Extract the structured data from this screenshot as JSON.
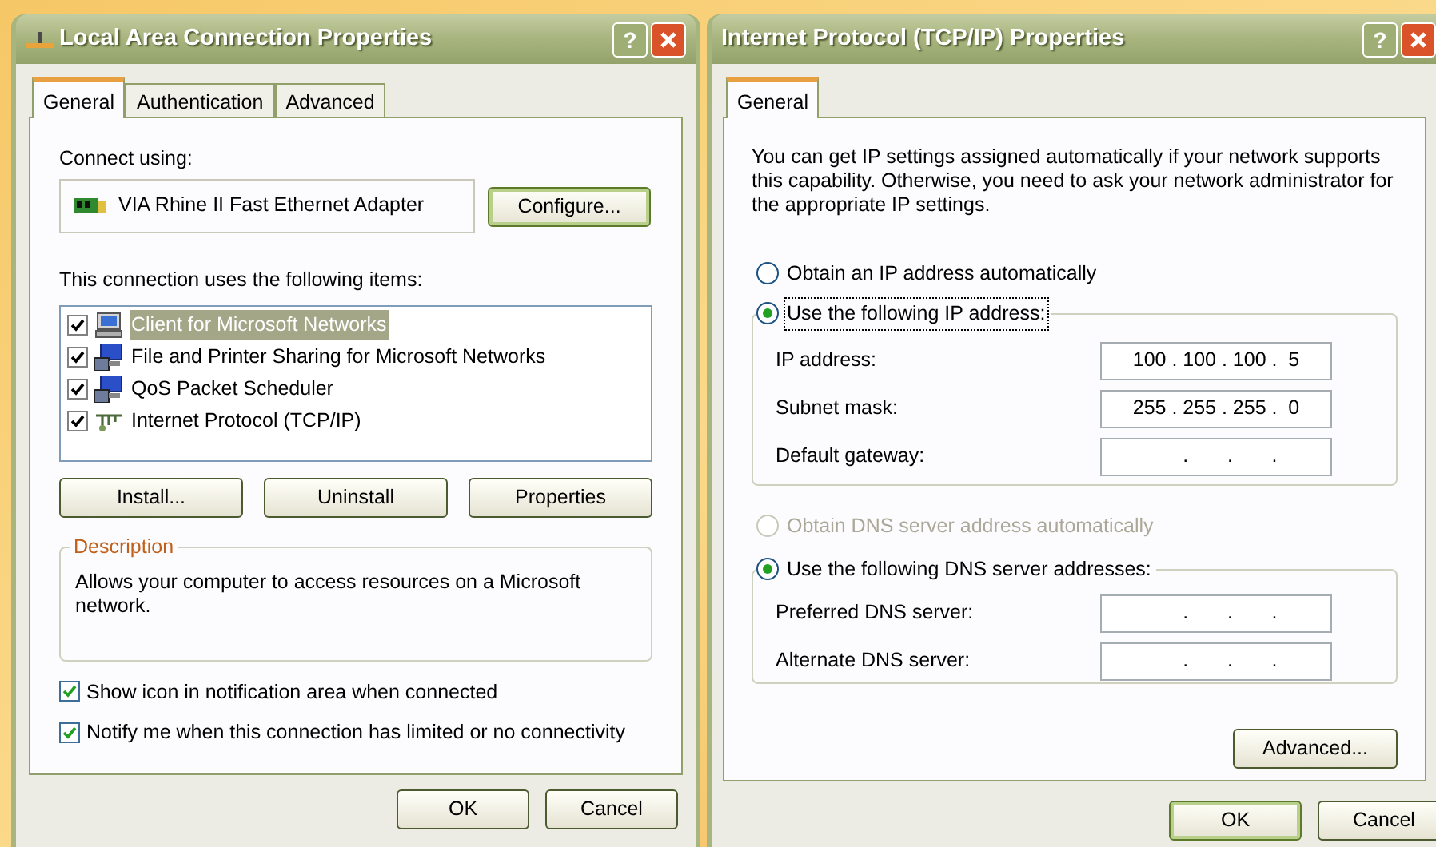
{
  "lan_dialog": {
    "title": "Local Area Connection Properties",
    "help_button": "?",
    "tabs": [
      {
        "label": "General",
        "selected": true
      },
      {
        "label": "Authentication",
        "selected": false
      },
      {
        "label": "Advanced",
        "selected": false
      }
    ],
    "connect_using_label": "Connect using:",
    "adapter": "VIA Rhine II Fast Ethernet Adapter",
    "configure_button": "Configure...",
    "items_label": "This connection uses the following items:",
    "items": [
      {
        "label": "Client for Microsoft Networks",
        "checked": true,
        "selected": true,
        "kind": "client"
      },
      {
        "label": "File and Printer Sharing for Microsoft Networks",
        "checked": true,
        "selected": false,
        "kind": "service"
      },
      {
        "label": "QoS Packet Scheduler",
        "checked": true,
        "selected": false,
        "kind": "service"
      },
      {
        "label": "Internet Protocol (TCP/IP)",
        "checked": true,
        "selected": false,
        "kind": "protocol"
      }
    ],
    "item_buttons": [
      "Install...",
      "Uninstall",
      "Properties"
    ],
    "description": {
      "legend": "Description",
      "text": "Allows your computer to access resources on a Microsoft network."
    },
    "options": [
      {
        "label": "Show icon in notification area when connected",
        "checked": true
      },
      {
        "label": "Notify me when this connection has limited or no connectivity",
        "checked": true
      }
    ],
    "buttons": [
      "OK",
      "Cancel"
    ]
  },
  "tcpip_dialog": {
    "title": "Internet Protocol (TCP/IP) Properties",
    "help_button": "?",
    "tabs": [
      {
        "label": "General",
        "selected": true
      }
    ],
    "intro": "You can get IP settings assigned automatically if your network supports this capability. Otherwise, you need to ask your network administrator for the appropriate IP settings.",
    "ip_modes": [
      {
        "label": "Obtain an IP address automatically",
        "selected": false,
        "disabled": false,
        "focused": false
      },
      {
        "label": "Use the following IP address:",
        "selected": true,
        "disabled": false,
        "focused": true
      }
    ],
    "ip_fields": [
      {
        "label": "IP address:",
        "value": "100 . 100 . 100 .  5"
      },
      {
        "label": "Subnet mask:",
        "value": "255 . 255 . 255 .  0"
      },
      {
        "label": "Default gateway:",
        "value": "     .       .       ."
      }
    ],
    "dns_modes": [
      {
        "label": "Obtain DNS server address automatically",
        "selected": false,
        "disabled": true,
        "focused": false
      },
      {
        "label": "Use the following DNS server addresses:",
        "selected": true,
        "disabled": false,
        "focused": false
      }
    ],
    "dns_fields": [
      {
        "label": "Preferred DNS server:",
        "value": "     .       .       ."
      },
      {
        "label": "Alternate DNS server:",
        "value": "     .       .       ."
      }
    ],
    "advanced_button": "Advanced...",
    "buttons": [
      "OK",
      "Cancel"
    ]
  }
}
